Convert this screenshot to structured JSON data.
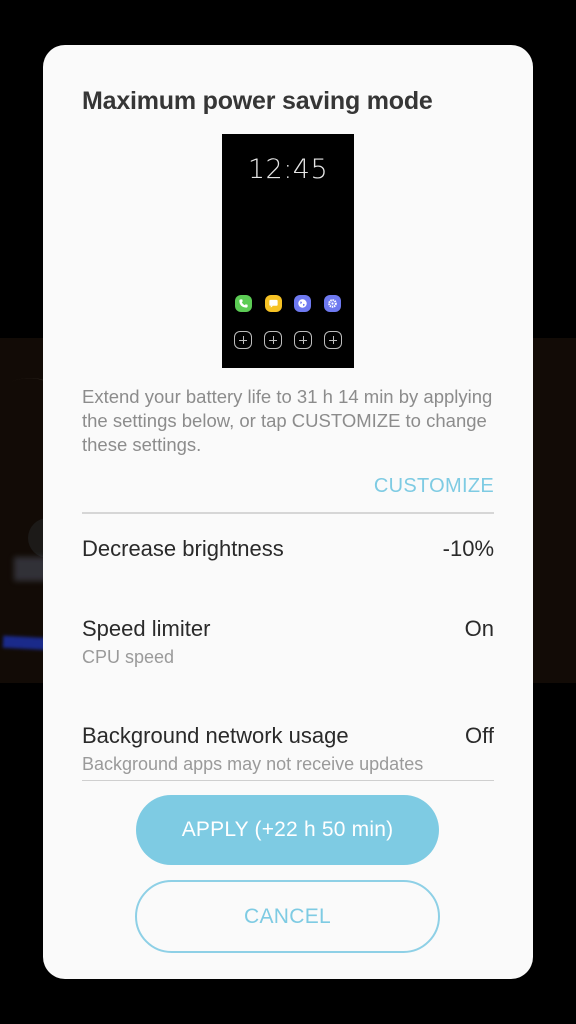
{
  "dialog": {
    "title": "Maximum power saving mode",
    "preview": {
      "clock": "12:45",
      "apps": [
        {
          "name": "phone-icon",
          "color": "#5ccc55"
        },
        {
          "name": "messages-icon",
          "color": "#f6c224"
        },
        {
          "name": "internet-icon",
          "color": "#6e79f0"
        },
        {
          "name": "settings-icon",
          "color": "#6e79f0"
        }
      ],
      "add_slots": 4
    },
    "description": "Extend your battery life to 31 h 14 min by applying the settings below, or tap CUSTOMIZE to change these settings.",
    "customize_label": "CUSTOMIZE",
    "settings": [
      {
        "label": "Decrease brightness",
        "value": "-10%",
        "subtitle": ""
      },
      {
        "label": "Speed limiter",
        "value": "On",
        "subtitle": "CPU speed"
      },
      {
        "label": "Background network usage",
        "value": "Off",
        "subtitle": "Background apps may not receive updates"
      }
    ],
    "apply_label": "APPLY (+22 h 50 min)",
    "cancel_label": "CANCEL"
  },
  "colors": {
    "accent": "#7ecbe3",
    "dialog_bg": "#fafafa",
    "title": "#363636",
    "secondary_text": "#8c8c8c"
  }
}
